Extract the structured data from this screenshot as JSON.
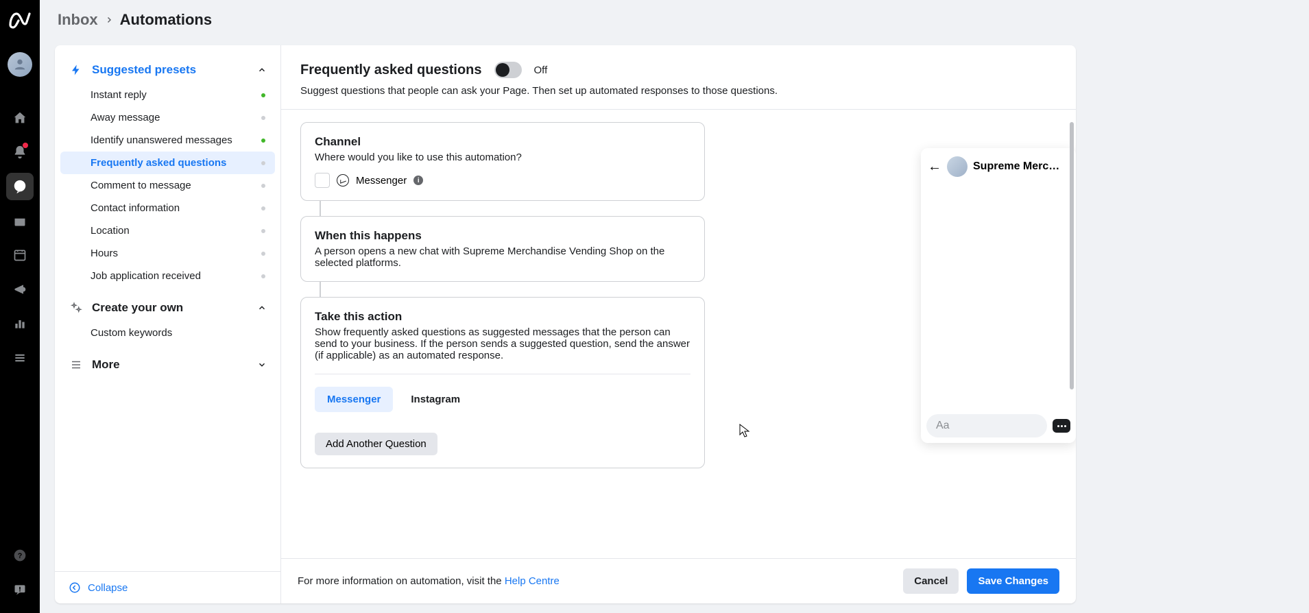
{
  "breadcrumb": {
    "parent": "Inbox",
    "current": "Automations"
  },
  "sidebar": {
    "suggested_label": "Suggested presets",
    "create_label": "Create your own",
    "more_label": "More",
    "collapse_label": "Collapse",
    "presets": [
      {
        "label": "Instant reply",
        "status": "on"
      },
      {
        "label": "Away message",
        "status": "off"
      },
      {
        "label": "Identify unanswered messages",
        "status": "on"
      },
      {
        "label": "Frequently asked questions",
        "status": "off"
      },
      {
        "label": "Comment to message",
        "status": "off"
      },
      {
        "label": "Contact information",
        "status": "off"
      },
      {
        "label": "Location",
        "status": "off"
      },
      {
        "label": "Hours",
        "status": "off"
      },
      {
        "label": "Job application received",
        "status": "off"
      }
    ],
    "create_items": [
      {
        "label": "Custom keywords"
      }
    ]
  },
  "header": {
    "title": "Frequently asked questions",
    "toggle_state": "Off",
    "subtitle": "Suggest questions that people can ask your Page. Then set up automated responses to those questions."
  },
  "sections": {
    "channel": {
      "title": "Channel",
      "desc": "Where would you like to use this automation?",
      "option_label": "Messenger"
    },
    "when": {
      "title": "When this happens",
      "desc": "A person opens a new chat with Supreme Merchandise Vending Shop on the selected platforms."
    },
    "action": {
      "title": "Take this action",
      "desc": "Show frequently asked questions as suggested messages that the person can send to your business. If the person sends a suggested question, send the answer (if applicable) as an automated response.",
      "tabs": [
        "Messenger",
        "Instagram"
      ],
      "add_button": "Add Another Question"
    }
  },
  "preview": {
    "page_name": "Supreme Merc…",
    "input_placeholder": "Aa"
  },
  "footer": {
    "text_prefix": "For more information on automation, visit the ",
    "link": "Help Centre",
    "cancel": "Cancel",
    "save": "Save Changes"
  },
  "colors": {
    "accent": "#1877f2",
    "rail": "#000000"
  }
}
